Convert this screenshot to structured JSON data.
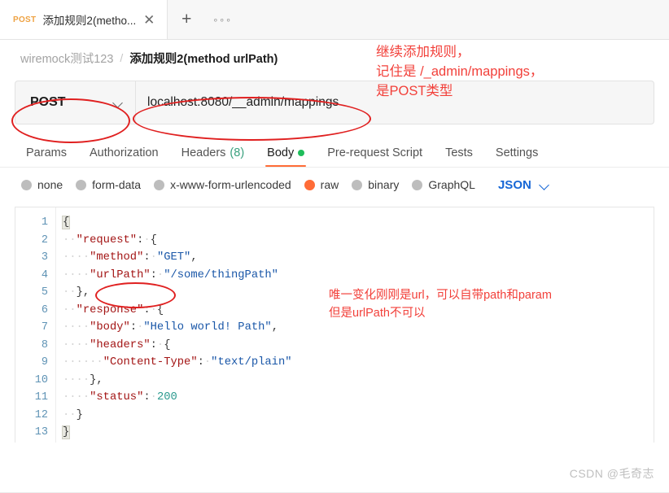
{
  "tabbar": {
    "tab_method": "POST",
    "tab_title": "添加规则2(metho...",
    "close_icon": "✕",
    "new_tab_icon": "+",
    "more_icon": "∘∘∘"
  },
  "breadcrumb": {
    "collection": "wiremock测试123",
    "separator": "/",
    "current": "添加规则2(method urlPath)"
  },
  "request": {
    "method": "POST",
    "url": "localhost:8080/__admin/mappings"
  },
  "request_tabs": [
    {
      "label": "Params",
      "count": "",
      "active": false,
      "dot": false
    },
    {
      "label": "Authorization",
      "count": "",
      "active": false,
      "dot": false
    },
    {
      "label": "Headers",
      "count": "(8)",
      "active": false,
      "dot": false
    },
    {
      "label": "Body",
      "count": "",
      "active": true,
      "dot": true
    },
    {
      "label": "Pre-request Script",
      "count": "",
      "active": false,
      "dot": false
    },
    {
      "label": "Tests",
      "count": "",
      "active": false,
      "dot": false
    },
    {
      "label": "Settings",
      "count": "",
      "active": false,
      "dot": false
    }
  ],
  "body_types": [
    {
      "label": "none",
      "selected": false
    },
    {
      "label": "form-data",
      "selected": false
    },
    {
      "label": "x-www-form-urlencoded",
      "selected": false
    },
    {
      "label": "raw",
      "selected": true
    },
    {
      "label": "binary",
      "selected": false
    },
    {
      "label": "GraphQL",
      "selected": false
    }
  ],
  "body_format": "JSON",
  "editor": {
    "line_numbers": [
      "1",
      "2",
      "3",
      "4",
      "5",
      "6",
      "7",
      "8",
      "9",
      "10",
      "11",
      "12",
      "13"
    ],
    "raw_body": "{\n  \"request\": {\n    \"method\": \"GET\",\n    \"urlPath\": \"/some/thingPath\"\n  },\n  \"response\": {\n    \"body\": \"Hello world! Path\",\n    \"headers\": {\n      \"Content-Type\": \"text/plain\"\n    },\n    \"status\": 200\n  }\n}"
  },
  "annotations": {
    "top": "继续添加规则，\n记住是 /_admin/mappings，\n是POST类型",
    "code": "唯一变化刚刚是url，可以自带path和param\n但是urlPath不可以"
  },
  "watermark": "CSDN @毛奇志",
  "colors": {
    "accent_orange": "#ff6c37",
    "annotation_red": "#f2403a",
    "ellipse_red": "#e02020",
    "link_blue": "#1767d6",
    "green_dot": "#1fbd5b"
  }
}
